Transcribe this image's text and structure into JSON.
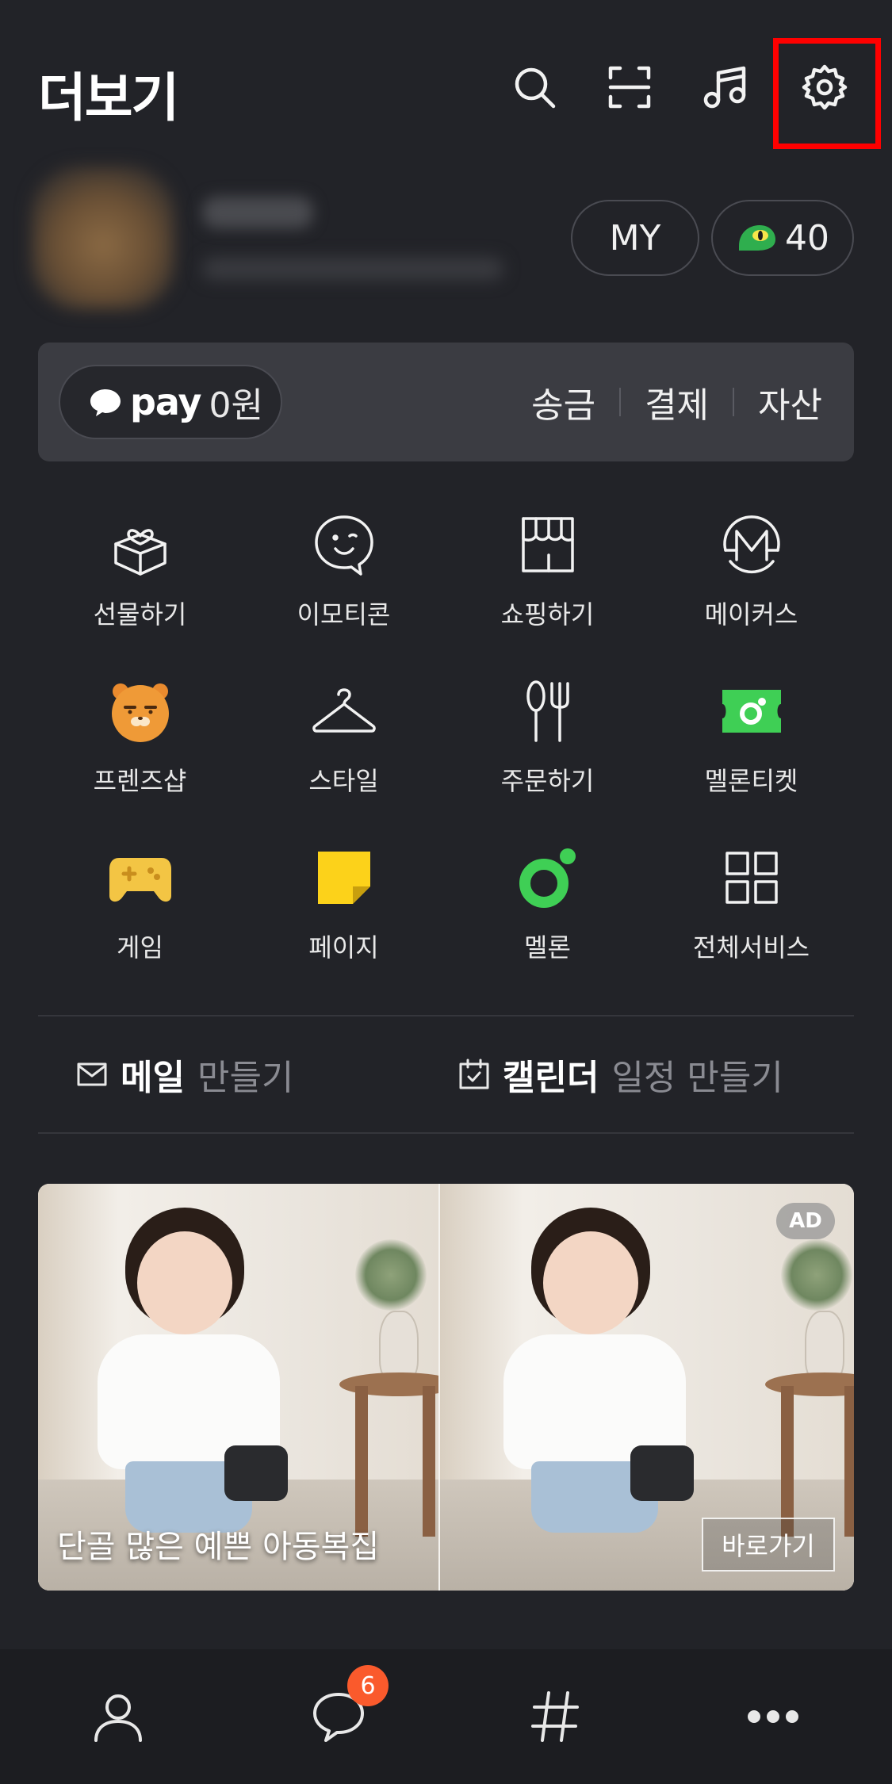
{
  "header": {
    "title": "더보기",
    "icons": [
      "search-icon",
      "scan-icon",
      "music-icon",
      "settings-icon"
    ]
  },
  "profile": {
    "my_label": "MY",
    "coin_count": "40"
  },
  "pay": {
    "logo": "pay",
    "amount": "0원",
    "links": [
      "송금",
      "결제",
      "자산"
    ]
  },
  "services": [
    {
      "label": "선물하기",
      "icon": "gift-icon"
    },
    {
      "label": "이모티콘",
      "icon": "emoticon-icon"
    },
    {
      "label": "쇼핑하기",
      "icon": "shop-icon"
    },
    {
      "label": "메이커스",
      "icon": "makers-icon"
    },
    {
      "label": "프렌즈샵",
      "icon": "friends-ryan-icon"
    },
    {
      "label": "스타일",
      "icon": "hanger-icon"
    },
    {
      "label": "주문하기",
      "icon": "utensils-icon"
    },
    {
      "label": "멜론티켓",
      "icon": "melon-ticket-icon"
    },
    {
      "label": "게임",
      "icon": "gamepad-icon"
    },
    {
      "label": "페이지",
      "icon": "page-icon"
    },
    {
      "label": "멜론",
      "icon": "melon-icon"
    },
    {
      "label": "전체서비스",
      "icon": "grid-icon"
    }
  ],
  "shortcuts": {
    "mail": {
      "main": "메일",
      "sub": "만들기"
    },
    "calendar": {
      "main": "캘린더",
      "sub": "일정 만들기"
    }
  },
  "ad": {
    "caption": "단골 많은 예쁜 아동복집",
    "badge": "AD",
    "button": "바로가기"
  },
  "bottom_nav": {
    "items": [
      "friends-icon",
      "chat-icon",
      "hashtag-icon",
      "more-icon"
    ],
    "chat_badge": "6"
  },
  "colors": {
    "background": "#222328",
    "highlight": "#ff0000",
    "badge": "#fa5a2c",
    "melon_green": "#4cd964"
  }
}
